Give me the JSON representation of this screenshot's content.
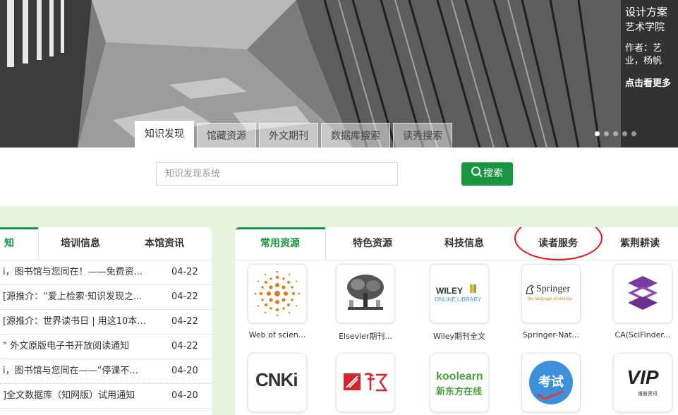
{
  "banner": {
    "caption_line1": "设计方案",
    "caption_line2": "艺术学院",
    "caption_line3": "作者：艺",
    "caption_line4": "业，杨帆",
    "more_link": "点击看更多"
  },
  "search": {
    "tabs": [
      "知识发现",
      "馆藏资源",
      "外文期刊",
      "数据库搜索",
      "读秀搜索"
    ],
    "active_tab": 0,
    "placeholder": "知识发现系统",
    "button_label": "搜索"
  },
  "news": {
    "tabs": [
      "知",
      "培训信息",
      "本馆资讯"
    ],
    "items": [
      {
        "title": "i，图书馆与您同在！——免费资...",
        "date": "04-22"
      },
      {
        "title": "[源推介：“爱上检索·知识发现之...",
        "date": "04-22"
      },
      {
        "title": "[源推介：世界读书日 | 用这10本...",
        "date": "04-22"
      },
      {
        "title": "\" 外文原版电子书开放阅读通知",
        "date": "04-22"
      },
      {
        "title": "i，图书馆与您同在——“停课不...",
        "date": "04-20"
      },
      {
        "title": "]全文数据库（知网版）试用通知",
        "date": "04-20"
      }
    ]
  },
  "resources": {
    "tabs": [
      "常用资源",
      "特色资源",
      "科技信息",
      "读者服务",
      "紫荆耕读"
    ],
    "highlighted_tab": "读者服务",
    "tiles_row1": [
      {
        "name": "Web of scien...",
        "icon": "web-of-science-logo"
      },
      {
        "name": "Elsevier期刊...",
        "icon": "elsevier-tree-logo"
      },
      {
        "name": "Wiley期刊全文",
        "icon": "wiley-logo"
      },
      {
        "name": "Springer-Nat...",
        "icon": "springer-logo"
      },
      {
        "name": "CA(SciFinder...",
        "icon": "scifinder-logo"
      }
    ],
    "tiles_row2": [
      {
        "name": "",
        "icon": "cnki-logo"
      },
      {
        "name": "",
        "icon": "chaoxing-logo"
      },
      {
        "name": "",
        "icon": "koolearn-logo"
      },
      {
        "name": "",
        "icon": "exam-logo"
      },
      {
        "name": "",
        "icon": "vip-logo"
      }
    ],
    "logo_text": {
      "wiley": "WILEY",
      "wiley_sub": "ONLINE LIBRARY",
      "springer": "Springer",
      "springer_sub": "the language of science",
      "cnki": "CNKi",
      "koolearn": "koolearn",
      "koolearn_sub": "新东方在线",
      "exam": "考试",
      "vip": "VIP",
      "vip_sub": "维普资讯"
    }
  },
  "colors": {
    "accent_green": "#17953f",
    "panel_bg": "#e6f4df",
    "highlight_circle": "#e11111"
  }
}
